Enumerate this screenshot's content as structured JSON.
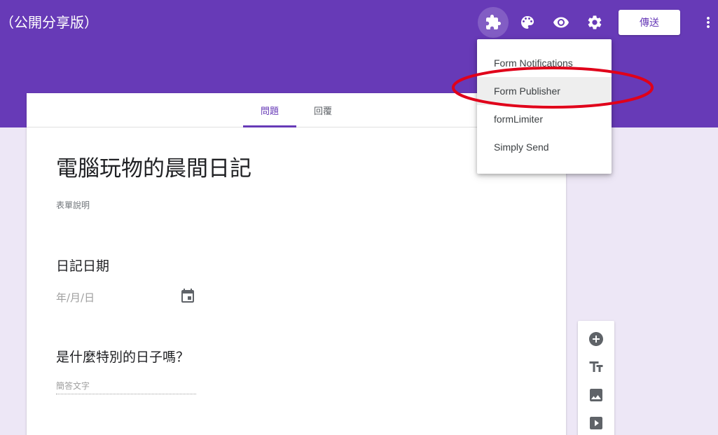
{
  "header": {
    "form_title": "（公開分享版）",
    "send_label": "傳送",
    "icons": [
      "puzzle-icon",
      "palette-icon",
      "eye-icon",
      "gear-icon",
      "more-vert-icon"
    ]
  },
  "tabs": [
    {
      "label": "問題",
      "active": true
    },
    {
      "label": "回覆",
      "active": false
    }
  ],
  "form": {
    "title": "電腦玩物的晨間日記",
    "description": "表單說明",
    "questions": [
      {
        "title": "日記日期",
        "placeholder": "年/月/日"
      },
      {
        "title": "是什麼特別的日子嗎？",
        "placeholder": "簡答文字"
      }
    ]
  },
  "addon_menu": {
    "items": [
      {
        "label": "Form Notifications"
      },
      {
        "label": "Form Publisher",
        "highlighted": true
      },
      {
        "label": "formLimiter"
      },
      {
        "label": "Simply Send"
      }
    ]
  },
  "side_tools": [
    "add-circle-icon",
    "title-text-icon",
    "image-icon",
    "video-icon"
  ],
  "colors": {
    "accent": "#673ab7",
    "background": "#ede7f6",
    "annotation": "#e0001a"
  }
}
